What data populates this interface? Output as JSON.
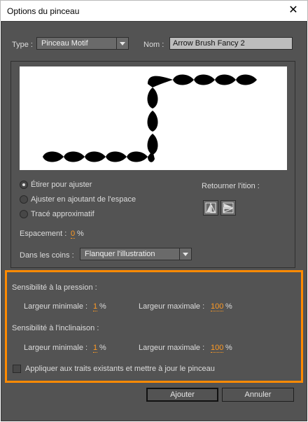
{
  "window": {
    "title": "Options du pinceau",
    "close_glyph": "✕"
  },
  "type": {
    "label": "Type :",
    "value": "Pinceau Motif"
  },
  "name": {
    "label": "Nom :",
    "value": "Arrow Brush Fancy 2"
  },
  "fit_options": [
    {
      "label": "Étirer pour ajuster",
      "selected": true
    },
    {
      "label": "Ajuster en ajoutant de l'espace",
      "selected": false
    },
    {
      "label": "Tracé approximatif",
      "selected": false
    }
  ],
  "flip": {
    "label": "Retourner l'ition :",
    "buttons": [
      "flip-along-icon",
      "flip-across-icon"
    ]
  },
  "spacing": {
    "label": "Espacement :",
    "value": "0",
    "unit": "%"
  },
  "corners": {
    "label": "Dans les coins :",
    "value": "Flanquer l'illustration"
  },
  "pressure": {
    "title": "Sensibilité à la pression :",
    "min_label": "Largeur minimale :",
    "min_value": "1",
    "min_unit": "%",
    "max_label": "Largeur maximale :",
    "max_value": "100",
    "max_unit": "%"
  },
  "tilt": {
    "title": "Sensibilité à l'inclinaison :",
    "min_label": "Largeur minimale :",
    "min_value": "1",
    "min_unit": "%",
    "max_label": "Largeur maximale :",
    "max_value": "100",
    "max_unit": "%"
  },
  "apply_existing": {
    "label": "Appliquer aux traits existants et mettre à jour le pinceau",
    "checked": false
  },
  "buttons": {
    "ok": "Ajouter",
    "cancel": "Annuler"
  },
  "colors": {
    "dialog_bg": "#535353",
    "accent": "#ff9a23",
    "highlight": "#ff8a00"
  }
}
